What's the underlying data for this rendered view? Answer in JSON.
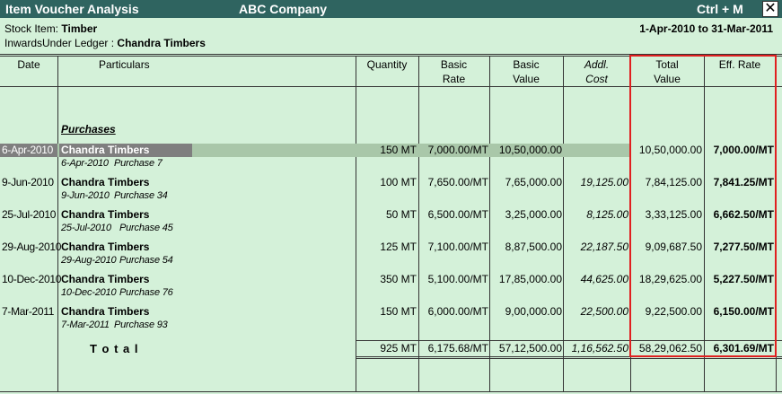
{
  "title_bar": {
    "report_name": "Item Voucher Analysis",
    "company": "ABC Company",
    "shortcut": "Ctrl + M",
    "close_glyph": "✕"
  },
  "header": {
    "stock_item_label": "Stock Item:",
    "stock_item_value": "Timber",
    "ledger_label": "InwardsUnder Ledger :",
    "ledger_value": "Chandra Timbers",
    "period": "1-Apr-2010 to 31-Mar-2011"
  },
  "columns": {
    "date": "Date",
    "particulars": "Particulars",
    "quantity": "Quantity",
    "basic_rate_1": "Basic",
    "basic_rate_2": "Rate",
    "basic_value_1": "Basic",
    "basic_value_2": "Value",
    "addl_cost_1": "Addl.",
    "addl_cost_2": "Cost",
    "total_value_1": "Total",
    "total_value_2": "Value",
    "eff_rate": "Eff. Rate"
  },
  "group_heading": "Purchases",
  "rows": [
    {
      "date": "6-Apr-2010",
      "party": "Chandra Timbers",
      "sub_date": "6-Apr-2010",
      "voucher": "Purchase 7",
      "qty": "150 MT",
      "rate": "7,000.00/MT",
      "basic_value": "10,50,000.00",
      "addl_cost": "",
      "total_value": "10,50,000.00",
      "eff_rate": "7,000.00/MT"
    },
    {
      "date": "9-Jun-2010",
      "party": "Chandra Timbers",
      "sub_date": "9-Jun-2010",
      "voucher": "Purchase 34",
      "qty": "100 MT",
      "rate": "7,650.00/MT",
      "basic_value": "7,65,000.00",
      "addl_cost": "19,125.00",
      "total_value": "7,84,125.00",
      "eff_rate": "7,841.25/MT"
    },
    {
      "date": "25-Jul-2010",
      "party": "Chandra Timbers",
      "sub_date": "25-Jul-2010",
      "voucher": "Purchase 45",
      "qty": "50 MT",
      "rate": "6,500.00/MT",
      "basic_value": "3,25,000.00",
      "addl_cost": "8,125.00",
      "total_value": "3,33,125.00",
      "eff_rate": "6,662.50/MT"
    },
    {
      "date": "29-Aug-2010",
      "party": "Chandra Timbers",
      "sub_date": "29-Aug-2010",
      "voucher": "Purchase 54",
      "qty": "125 MT",
      "rate": "7,100.00/MT",
      "basic_value": "8,87,500.00",
      "addl_cost": "22,187.50",
      "total_value": "9,09,687.50",
      "eff_rate": "7,277.50/MT"
    },
    {
      "date": "10-Dec-2010",
      "party": "Chandra Timbers",
      "sub_date": "10-Dec-2010",
      "voucher": "Purchase 76",
      "qty": "350 MT",
      "rate": "5,100.00/MT",
      "basic_value": "17,85,000.00",
      "addl_cost": "44,625.00",
      "total_value": "18,29,625.00",
      "eff_rate": "5,227.50/MT"
    },
    {
      "date": "7-Mar-2011",
      "party": "Chandra Timbers",
      "sub_date": "7-Mar-2011",
      "voucher": "Purchase 93",
      "qty": "150 MT",
      "rate": "6,000.00/MT",
      "basic_value": "9,00,000.00",
      "addl_cost": "22,500.00",
      "total_value": "9,22,500.00",
      "eff_rate": "6,150.00/MT"
    }
  ],
  "total": {
    "label": "T o t a l",
    "qty": "925 MT",
    "rate": "6,175.68/MT",
    "basic_value": "57,12,500.00",
    "addl_cost": "1,16,562.50",
    "total_value": "58,29,062.50",
    "eff_rate": "6,301.69/MT"
  },
  "colors": {
    "background": "#d4f1d9",
    "title_bar": "#2f6460",
    "highlight_box": "#e02020",
    "selected_row": "#a9c7a9"
  }
}
